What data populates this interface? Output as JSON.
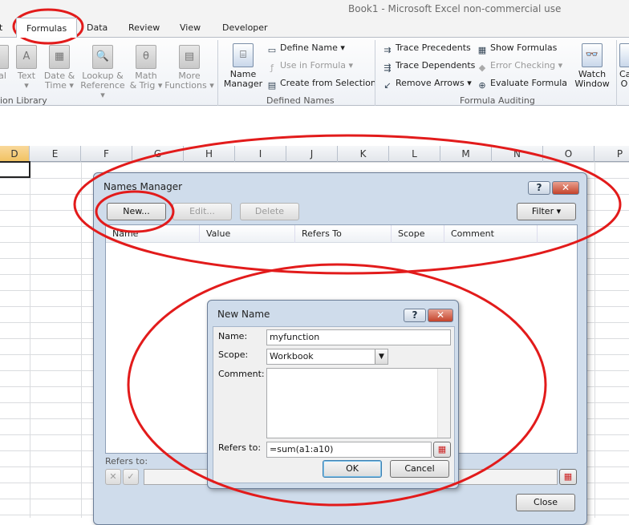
{
  "window": {
    "title": "Book1  -  Microsoft Excel non-commercial use",
    "partial_tab": "t"
  },
  "tabs": [
    {
      "label": "Formulas",
      "active": true
    },
    {
      "label": "Data"
    },
    {
      "label": "Review"
    },
    {
      "label": "View"
    },
    {
      "label": "Developer"
    }
  ],
  "ribbon": {
    "function_library": {
      "group_label": "ion Library",
      "buttons": [
        {
          "label1": "al",
          "label2": ""
        },
        {
          "label1": "Text",
          "label2": "▾",
          "icon_glyph": "A"
        },
        {
          "label1": "Date &",
          "label2": "Time ▾",
          "icon_glyph": "▦"
        },
        {
          "label1": "Lookup &",
          "label2": "Reference ▾",
          "icon_glyph": "🔍"
        },
        {
          "label1": "Math",
          "label2": "& Trig ▾",
          "icon_glyph": "θ"
        },
        {
          "label1": "More",
          "label2": "Functions ▾",
          "icon_glyph": "▤"
        }
      ]
    },
    "defined_names": {
      "group_label": "Defined Names",
      "name_manager": {
        "label1": "Name",
        "label2": "Manager",
        "icon_glyph": "⌸"
      },
      "define_name": "Define Name ▾",
      "use_in_formula": "Use in Formula ▾",
      "create_from_selection": "Create from Selection"
    },
    "formula_auditing": {
      "group_label": "Formula Auditing",
      "trace_precedents": "Trace Precedents",
      "trace_dependents": "Trace Dependents",
      "remove_arrows": "Remove Arrows ▾",
      "show_formulas": "Show Formulas",
      "error_checking": "Error Checking ▾",
      "evaluate_formula": "Evaluate Formula",
      "watch_window": {
        "label1": "Watch",
        "label2": "Window",
        "icon_glyph": "👓"
      },
      "partial": {
        "label1": "Ca",
        "label2": "O"
      }
    }
  },
  "sheet": {
    "columns": [
      "D",
      "E",
      "F",
      "G",
      "H",
      "I",
      "J",
      "K",
      "L",
      "M",
      "N",
      "O",
      "P"
    ],
    "selected_column": "D"
  },
  "name_manager": {
    "title": "Names Manager",
    "help_label": "?",
    "close_x": "✕",
    "new_label": "New...",
    "edit_label": "Edit...",
    "delete_label": "Delete",
    "filter_label": "Filter ▾",
    "columns": [
      "Name",
      "Value",
      "Refers To",
      "Scope",
      "Comment"
    ],
    "refers_to_label": "Refers to:",
    "cancel_glyph": "✕",
    "confirm_glyph": "✓",
    "close_label": "Close"
  },
  "new_name": {
    "title": "New Name",
    "help_label": "?",
    "close_x": "✕",
    "name_label": "Name:",
    "name_value": "myfunction",
    "scope_label": "Scope:",
    "scope_value": "Workbook",
    "comment_label": "Comment:",
    "comment_value": "",
    "refers_to_label": "Refers to:",
    "refers_to_value": "=sum(a1:a10)",
    "ok_label": "OK",
    "cancel_label": "Cancel"
  },
  "colors": {
    "annotation_red": "#e21b1b",
    "dialog_frame": "#cfdceb",
    "selected_header": "#f1c15f"
  }
}
